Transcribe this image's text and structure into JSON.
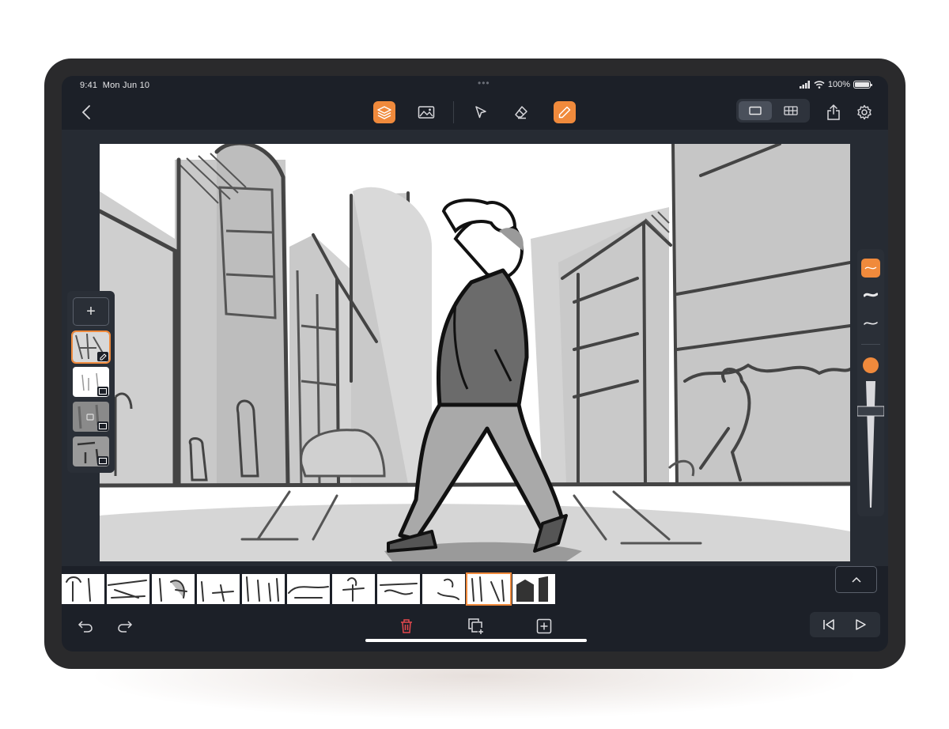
{
  "status": {
    "time": "9:41",
    "date": "Mon Jun 10",
    "battery": "100%"
  },
  "toolbar": {
    "back_icon": "chevron-left-icon",
    "tools": [
      "layers-icon",
      "image-icon",
      "select-arrow-icon",
      "eraser-icon",
      "pencil-icon"
    ],
    "active_tools": [
      "layers-icon",
      "pencil-icon"
    ],
    "view_modes": [
      "single-frame-icon",
      "grid-icon"
    ],
    "active_view": "single-frame-icon",
    "actions": [
      "share-icon",
      "settings-icon"
    ]
  },
  "layers_panel": {
    "add_label": "+",
    "layers": [
      {
        "badge": "pencil-icon",
        "selected": true
      },
      {
        "badge": "image-icon",
        "selected": false
      },
      {
        "badge": "image-icon",
        "selected": false,
        "locked": true
      },
      {
        "badge": "image-icon",
        "selected": false
      }
    ]
  },
  "brush_panel": {
    "brushes": [
      "thin-stroke-icon",
      "bold-stroke-icon",
      "medium-stroke-icon"
    ],
    "active_brush": "thin-stroke-icon",
    "color": "#f08a3c",
    "size_level": 0.23
  },
  "filmstrip": {
    "frame_count": 11,
    "selected_index": 9
  },
  "bottombar": {
    "left": [
      "undo-icon",
      "redo-icon"
    ],
    "center": [
      "delete-icon",
      "duplicate-frame-icon",
      "add-frame-icon"
    ],
    "right": [
      "skip-to-start-icon",
      "play-icon"
    ]
  },
  "colors": {
    "accent": "#f08a3c",
    "delete": "#e5484d",
    "bg": "#1c2028"
  }
}
